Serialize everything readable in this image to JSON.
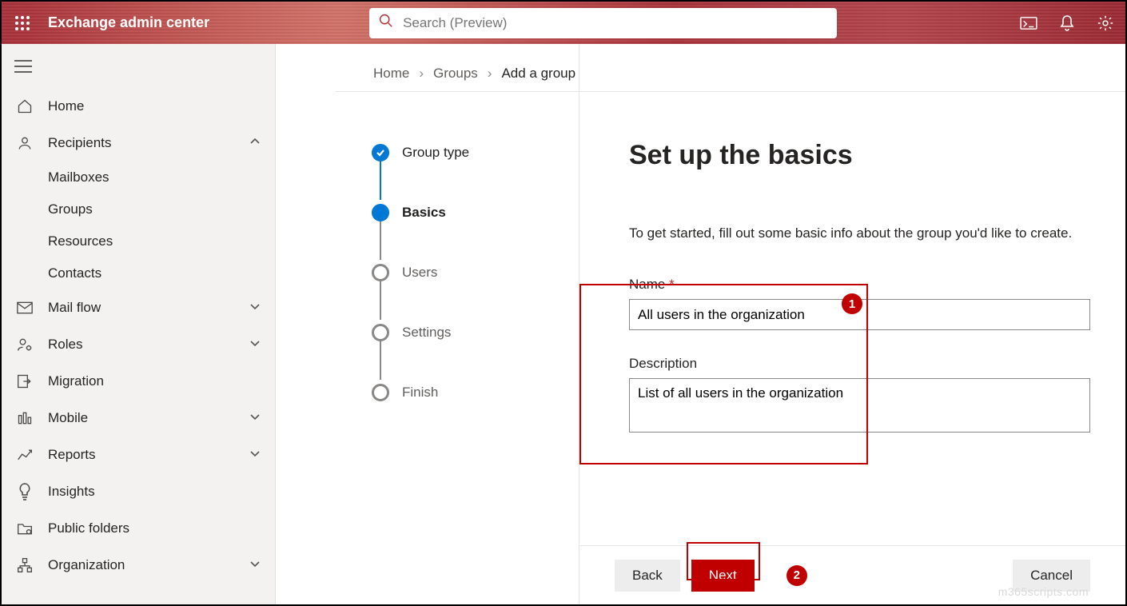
{
  "header": {
    "brand": "Exchange admin center",
    "search_placeholder": "Search (Preview)"
  },
  "sidebar": {
    "items": [
      {
        "label": "Home"
      },
      {
        "label": "Recipients"
      },
      {
        "label": "Mail flow"
      },
      {
        "label": "Roles"
      },
      {
        "label": "Migration"
      },
      {
        "label": "Mobile"
      },
      {
        "label": "Reports"
      },
      {
        "label": "Insights"
      },
      {
        "label": "Public folders"
      },
      {
        "label": "Organization"
      }
    ],
    "recipients_children": [
      {
        "label": "Mailboxes"
      },
      {
        "label": "Groups"
      },
      {
        "label": "Resources"
      },
      {
        "label": "Contacts"
      }
    ]
  },
  "breadcrumb": {
    "home": "Home",
    "groups": "Groups",
    "current": "Add a group"
  },
  "stepper": {
    "step0": "Group type",
    "step1": "Basics",
    "step2": "Users",
    "step3": "Settings",
    "step4": "Finish"
  },
  "form": {
    "title": "Set up the basics",
    "subtitle": "To get started, fill out some basic info about the group you'd like to create.",
    "name_label": "Name",
    "name_value": "All users in the organization",
    "desc_label": "Description",
    "desc_value": "List of all users in the organization"
  },
  "buttons": {
    "back": "Back",
    "next": "Next",
    "cancel": "Cancel"
  },
  "annotations": {
    "badge1": "1",
    "badge2": "2"
  },
  "watermark": "m365scripts.com"
}
